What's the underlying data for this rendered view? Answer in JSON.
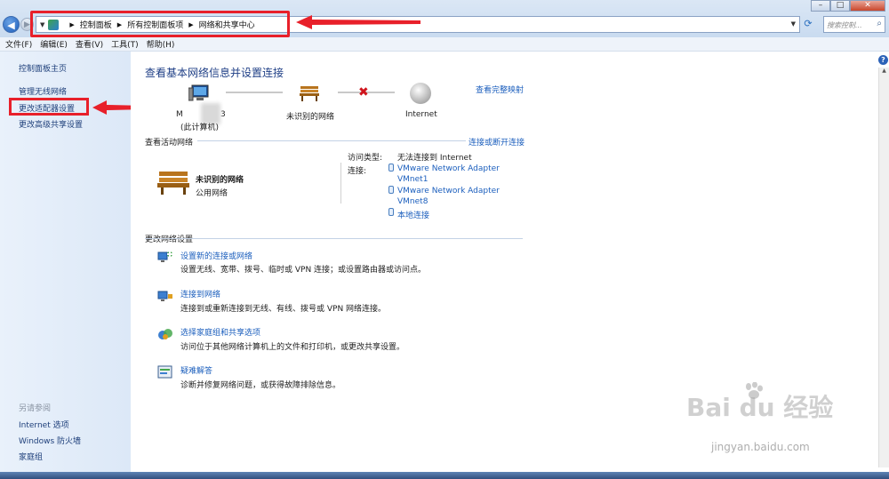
{
  "window": {
    "breadcrumbs": [
      "控制面板",
      "所有控制面板项",
      "网络和共享中心"
    ],
    "search_placeholder": "搜索控制..."
  },
  "menu": [
    "文件(F)",
    "编辑(E)",
    "查看(V)",
    "工具(T)",
    "帮助(H)"
  ],
  "sidebar": {
    "items": [
      "控制面板主页",
      "管理无线网络",
      "更改适配器设置",
      "更改高级共享设置"
    ],
    "see_also_heading": "另请参阅",
    "see_also": [
      "Internet 选项",
      "Windows 防火墙",
      "家庭组"
    ]
  },
  "main": {
    "heading": "查看基本网络信息并设置连接",
    "full_map_link": "查看完整映射",
    "nodes": {
      "computer_label_left": "M",
      "computer_label_right": "3",
      "computer_sub": "(此计算机)",
      "network": "未识别的网络",
      "internet": "Internet"
    },
    "active_networks": {
      "label": "查看活动网络",
      "link": "连接或断开连接",
      "network_name": "未识别的网络",
      "network_type": "公用网络",
      "access_type_label": "访问类型:",
      "access_type_value": "无法连接到 Internet",
      "connections_label": "连接:",
      "connections": [
        "VMware Network Adapter",
        "VMnet1",
        "VMware Network Adapter",
        "VMnet8",
        "本地连接"
      ]
    },
    "change_settings": {
      "label": "更改网络设置",
      "tasks": [
        {
          "title": "设置新的连接或网络",
          "desc": "设置无线、宽带、拨号、临时或 VPN 连接；或设置路由器或访问点。"
        },
        {
          "title": "连接到网络",
          "desc": "连接到或重新连接到无线、有线、拨号或 VPN 网络连接。"
        },
        {
          "title": "选择家庭组和共享选项",
          "desc": "访问位于其他网络计算机上的文件和打印机，或更改共享设置。"
        },
        {
          "title": "疑难解答",
          "desc": "诊断并修复网络问题，或获得故障排除信息。"
        }
      ]
    }
  },
  "watermark": {
    "brand": "Bai du 经验",
    "url": "jingyan.baidu.com"
  },
  "colors": {
    "link": "#1c5fbd",
    "heading": "#1f3f86",
    "highlight": "#e8202a"
  }
}
